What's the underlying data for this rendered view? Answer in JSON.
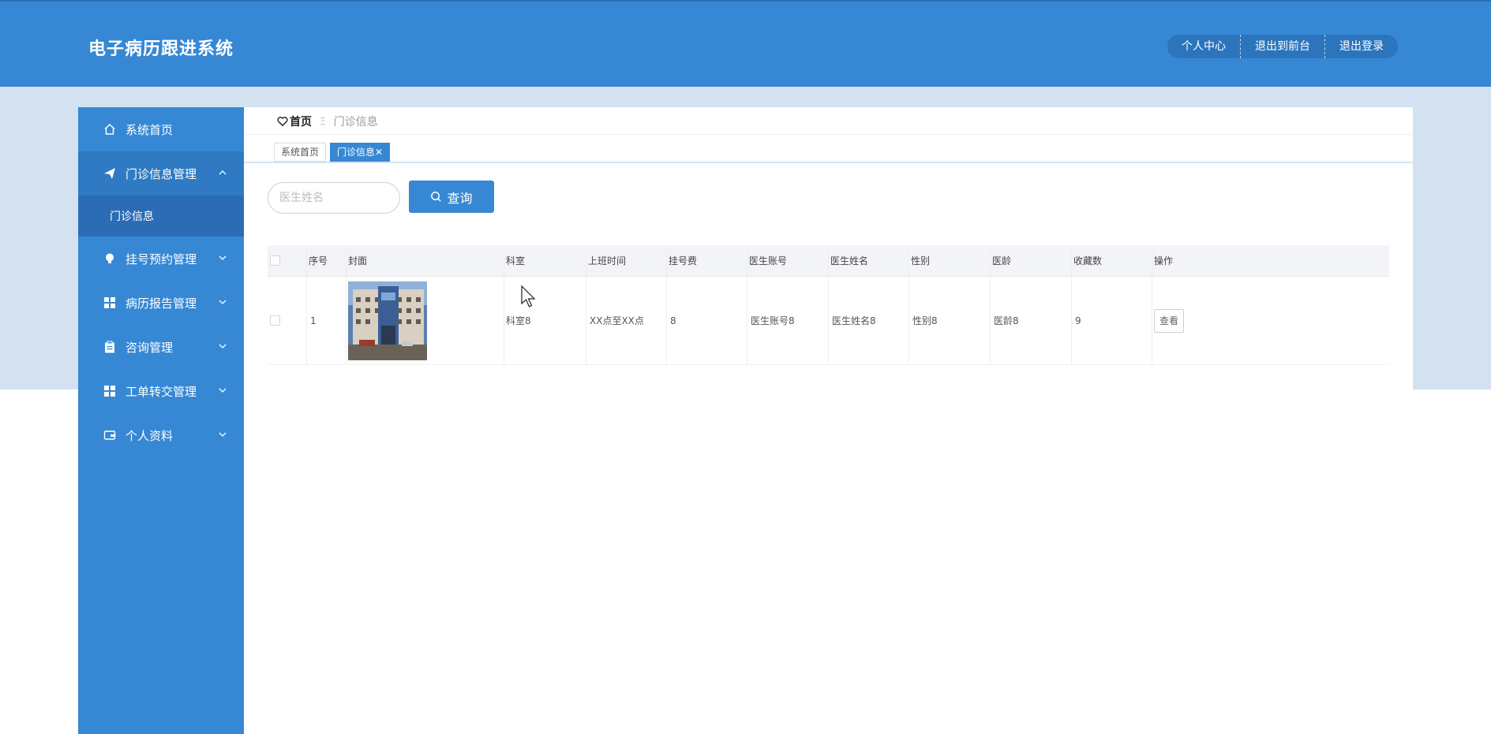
{
  "header": {
    "title": "电子病历跟进系统",
    "actions": [
      "个人中心",
      "退出到前台",
      "退出登录"
    ]
  },
  "sidebar": {
    "items": [
      {
        "label": "系统首页",
        "icon": "home-icon"
      },
      {
        "label": "门诊信息管理",
        "icon": "send-icon",
        "expanded": true,
        "children": [
          "门诊信息"
        ]
      },
      {
        "label": "挂号预约管理",
        "icon": "bulb-icon"
      },
      {
        "label": "病历报告管理",
        "icon": "grid-icon"
      },
      {
        "label": "咨询管理",
        "icon": "clipboard-icon"
      },
      {
        "label": "工单转交管理",
        "icon": "grid-icon"
      },
      {
        "label": "个人资料",
        "icon": "wallet-icon"
      }
    ]
  },
  "breadcrumb": {
    "home": "首页",
    "separator": "Ξ",
    "current": "门诊信息"
  },
  "tabs": [
    {
      "label": "系统首页",
      "active": false
    },
    {
      "label": "门诊信息",
      "active": true,
      "close": "✕"
    }
  ],
  "search": {
    "placeholder": "医生姓名",
    "button": "查询"
  },
  "table": {
    "headers": [
      "序号",
      "封面",
      "科室",
      "上班时间",
      "挂号费",
      "医生账号",
      "医生姓名",
      "性别",
      "医龄",
      "收藏数",
      "操作"
    ],
    "rows": [
      {
        "index": "1",
        "department": "科室8",
        "hours": "XX点至XX点",
        "fee": "8",
        "account": "医生账号8",
        "name": "医生姓名8",
        "gender": "性别8",
        "years": "医龄8",
        "favorites": "9",
        "action": "查看"
      }
    ]
  },
  "colors": {
    "primary": "#3688d4",
    "band": "#d3e1f1",
    "submenu": "#2b6cb4"
  }
}
